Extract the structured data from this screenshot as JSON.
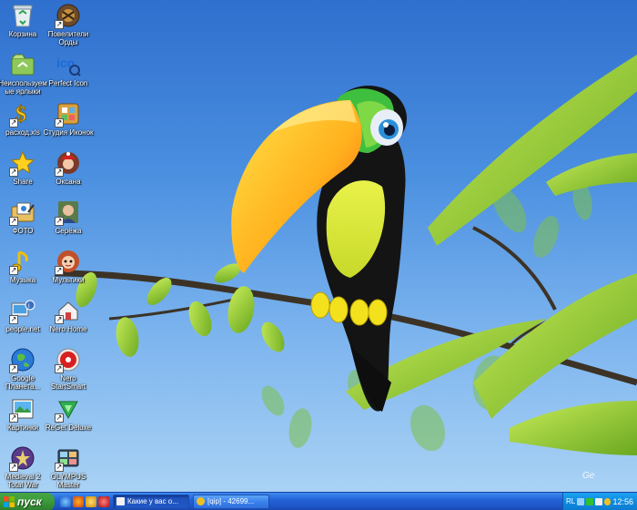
{
  "desktop": {
    "icons": [
      {
        "label": "Корзина",
        "icon": "recycle-bin-icon",
        "shortcut": false
      },
      {
        "label": "Повелители Орды",
        "icon": "game-icon",
        "shortcut": true
      },
      {
        "label": "Неиспользуемые ярлыки",
        "icon": "unused-shortcuts-icon",
        "shortcut": false
      },
      {
        "label": "Perfect Icon",
        "icon": "perfect-icon-icon",
        "shortcut": false
      },
      {
        "label": "расход.xls",
        "icon": "excel-file-icon",
        "shortcut": true
      },
      {
        "label": "Студия Иконок",
        "icon": "icon-studio-icon",
        "shortcut": true
      },
      {
        "label": "Share",
        "icon": "star-icon",
        "shortcut": true
      },
      {
        "label": "Оксана",
        "icon": "photo-icon",
        "shortcut": true
      },
      {
        "label": "ФОТО",
        "icon": "photo-folder-icon",
        "shortcut": true
      },
      {
        "label": "Серёжа",
        "icon": "photo-icon",
        "shortcut": true
      },
      {
        "label": "Музыка",
        "icon": "music-icon",
        "shortcut": true
      },
      {
        "label": "Мультики",
        "icon": "cartoon-icon",
        "shortcut": true
      },
      {
        "label": "people.net",
        "icon": "network-icon",
        "shortcut": true
      },
      {
        "label": "Nero Home",
        "icon": "nero-home-icon",
        "shortcut": true
      },
      {
        "label": "Google Планета...",
        "icon": "globe-icon",
        "shortcut": true
      },
      {
        "label": "Nero StartSmart",
        "icon": "nero-icon",
        "shortcut": true
      },
      {
        "label": "Картинки",
        "icon": "pictures-icon",
        "shortcut": true
      },
      {
        "label": "ReGet Deluxe",
        "icon": "download-icon",
        "shortcut": true
      },
      {
        "label": "Medieval 2 Total War",
        "icon": "medieval-icon",
        "shortcut": true
      },
      {
        "label": "OLYMPUS Master",
        "icon": "olympus-icon",
        "shortcut": true
      }
    ]
  },
  "taskbar": {
    "start_label": "пуск",
    "tasks": [
      {
        "label": "Какие у вас о...",
        "active": true
      },
      {
        "label": "[qip] - 42699...",
        "active": false
      }
    ],
    "tray": {
      "lang": "RL",
      "clock": "12:56"
    }
  },
  "colors": {
    "taskbar": "#2462d8",
    "start": "#3b9a3a",
    "sky": "#4a8fe0"
  }
}
